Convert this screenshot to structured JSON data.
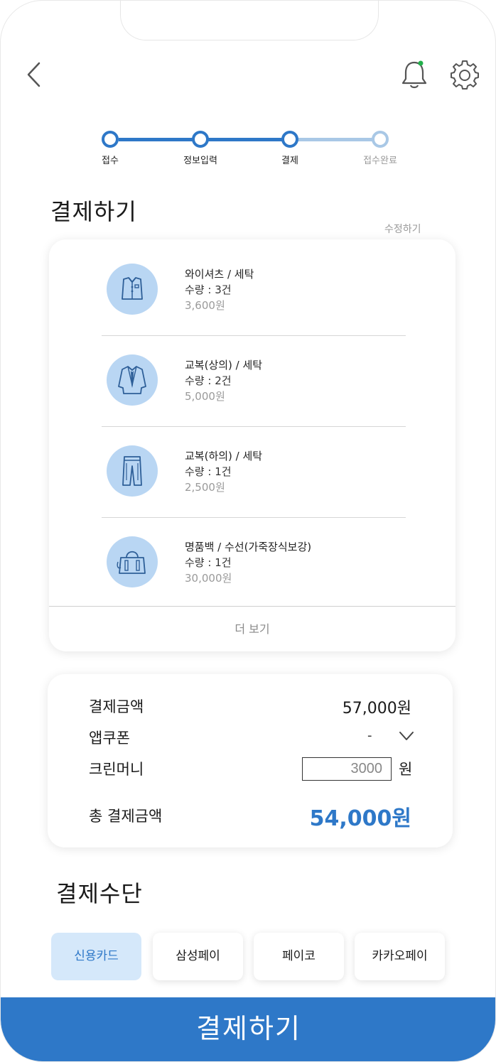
{
  "stepper": {
    "steps": [
      {
        "label": "접수",
        "state": "done"
      },
      {
        "label": "정보입력",
        "state": "done"
      },
      {
        "label": "결제",
        "state": "current"
      },
      {
        "label": "접수완료",
        "state": "todo"
      }
    ]
  },
  "page": {
    "title": "결제하기",
    "edit_label": "수정하기"
  },
  "items": [
    {
      "name": "와이셔츠 / 세탁",
      "qty": "수량 : 3건",
      "price": "3,600원",
      "icon": "shirt-icon"
    },
    {
      "name": "교복(상의) / 세탁",
      "qty": "수량 : 2건",
      "price": "5,000원",
      "icon": "uniform-jacket-icon"
    },
    {
      "name": "교복(하의) / 세탁",
      "qty": "수량 : 1건",
      "price": "2,500원",
      "icon": "pants-icon"
    },
    {
      "name": "명품백 / 수선(가죽장식보강)",
      "qty": "수량 : 1건",
      "price": "30,000원",
      "icon": "handbag-icon"
    }
  ],
  "more_label": "더 보기",
  "summary": {
    "payment_amount_label": "결제금액",
    "payment_amount_value": "57,000원",
    "coupon_label": "앱쿠폰",
    "coupon_value": "-",
    "cleanmoney_label": "크린머니",
    "cleanmoney_value": "3000",
    "cleanmoney_unit": "원",
    "total_label": "총 결제금액",
    "total_value": "54,000원"
  },
  "payment_methods": {
    "title": "결제수단",
    "options": [
      "신용카드",
      "삼성페이",
      "페이코",
      "카카오페이"
    ],
    "selected": "신용카드"
  },
  "submit_label": "결제하기",
  "colors": {
    "accent": "#2e78c8",
    "accent_light": "#a9c8e6",
    "icon_bg": "#b9d6f3",
    "selected_bg": "#d5e8fa",
    "notification_dot": "#22b04b"
  }
}
